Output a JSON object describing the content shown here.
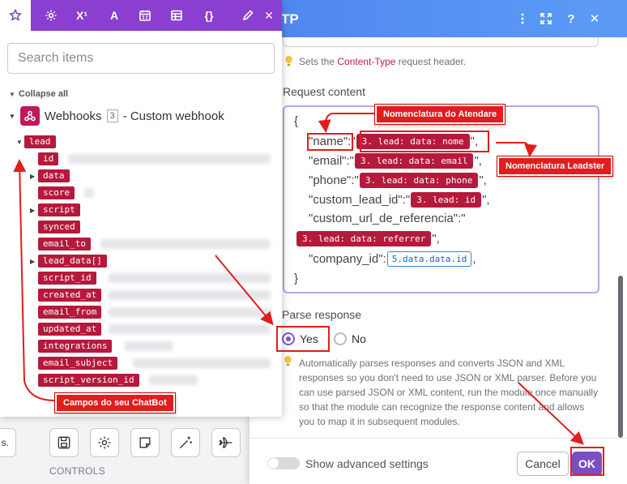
{
  "dialog": {
    "title": "TP",
    "content_type_hint_prefix": "Sets the",
    "content_type_hint_link": "Content-Type",
    "content_type_hint_suffix": "request header.",
    "request_content_label": "Request content",
    "code": {
      "open_brace": "{",
      "close_brace": "}",
      "name_key": "\"name\":\"",
      "name_pill": "3. lead: data: nome",
      "email_key": "\"email\":\"",
      "email_pill": "3. lead: data: email",
      "phone_key": "\"phone\":\"",
      "phone_pill": "3. lead: data: phone",
      "custom_lead_key": "\"custom_lead_id\":\"",
      "custom_lead_pill": "3. lead: id",
      "custom_url_key": "\"custom_url_de_referencia\":\"",
      "referrer_pill": "3. lead: data: referrer",
      "company_key": "\"company_id\":",
      "company_pill": "5.data.data.id",
      "quote_comma": "\",",
      "comma": ","
    },
    "parse_label": "Parse response",
    "parse_yes": "Yes",
    "parse_no": "No",
    "parse_help": "Automatically parses responses and converts JSON and XML responses so you don't need to use JSON or XML parser. Before you can use parsed JSON or XML content, run the module once manually so that the module can recognize the response content and allows you to map it in subsequent modules.",
    "advanced_label": "Show advanced settings",
    "cancel_label": "Cancel",
    "ok_label": "OK",
    "header_colors": [
      "#4f86ee",
      "#5b9bf7"
    ]
  },
  "panel": {
    "tab_labels": [
      "X¹",
      "A",
      "{}"
    ],
    "search_placeholder": "Search items",
    "collapse_label": "Collapse all",
    "webhook_name": "Webhooks",
    "webhook_count": "3",
    "webhook_type": "- Custom webhook",
    "items": {
      "lead": "lead",
      "id": "id",
      "data": "data",
      "score": "score",
      "script": "script",
      "synced": "synced",
      "email_to": "email_to",
      "lead_data": "lead_data[]",
      "script_id": "script_id",
      "created_at": "created_at",
      "email_from": "email_from",
      "updated_at": "updated_at",
      "integrations": "integrations",
      "email_subject": "email_subject",
      "script_version_id": "script_version_id"
    },
    "accent_color": "#8a3fd0",
    "tag_color": "#b5193c"
  },
  "background": {
    "more_label": "s.",
    "controls_label": "CONTROLS"
  },
  "annotations": {
    "atendare": "Nomenclatura do Atendare",
    "leadster": "Nomenclatura Leadster",
    "chatbot": "Campos do seu ChatBot",
    "color": "#e11d1d"
  }
}
